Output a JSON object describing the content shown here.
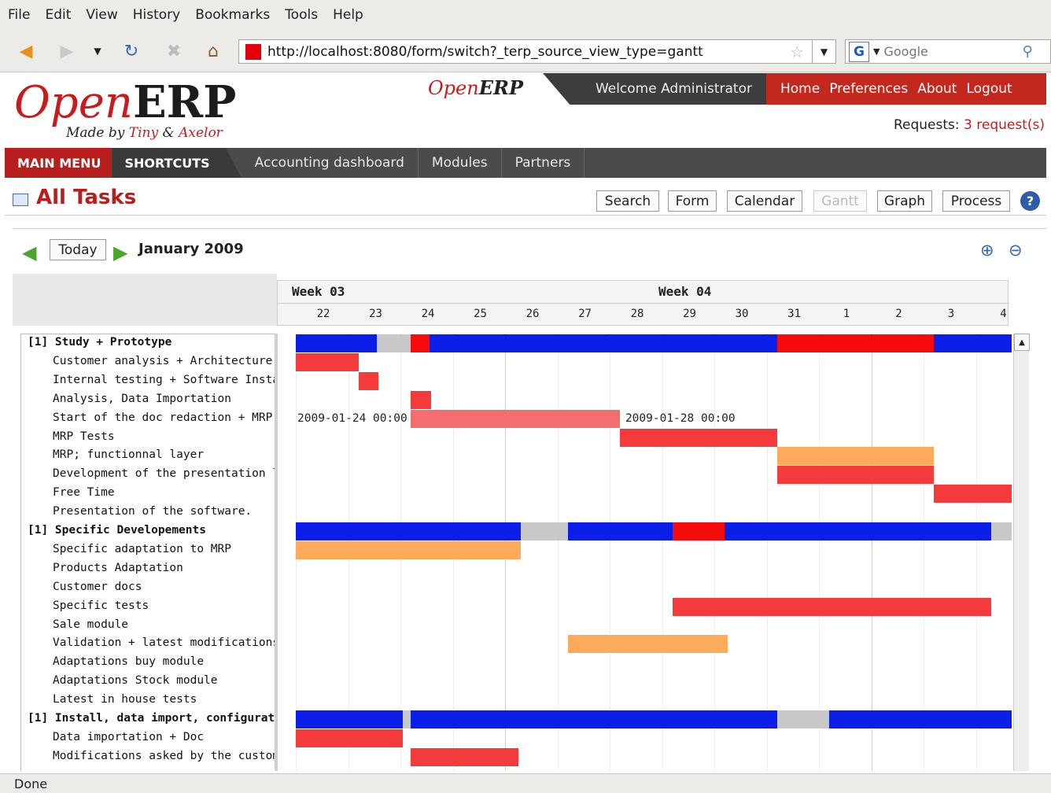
{
  "browser": {
    "menu": [
      "File",
      "Edit",
      "View",
      "History",
      "Bookmarks",
      "Tools",
      "Help"
    ],
    "url": "http://localhost:8080/form/switch?_terp_source_view_type=gantt",
    "search_placeholder": "Google",
    "status": "Done"
  },
  "erp": {
    "logo_open": "Open",
    "logo_erp": "ERP",
    "tagline_pre": "Made by ",
    "tagline_tiny": "Tiny",
    "tagline_mid": " & ",
    "tagline_axelor": "Axelor",
    "welcome": "Welcome Administrator",
    "top_links": [
      "Home",
      "Preferences",
      "About",
      "Logout"
    ],
    "requests_label": "Requests:",
    "requests_value": "3 request(s)",
    "nav": {
      "main_menu": "MAIN MENU",
      "shortcuts": "SHORTCUTS",
      "links": [
        "Accounting dashboard",
        "Modules",
        "Partners"
      ]
    },
    "page_title": "All Tasks",
    "view_buttons": [
      "Search",
      "Form",
      "Calendar",
      "Gantt",
      "Graph",
      "Process"
    ],
    "active_view": "Gantt"
  },
  "gantt": {
    "today_label": "Today",
    "month": "January 2009",
    "weeks": [
      "Week 03",
      "Week 04"
    ],
    "days": [
      "22",
      "23",
      "24",
      "25",
      "26",
      "27",
      "28",
      "29",
      "30",
      "31",
      "1",
      "2",
      "3",
      "4"
    ],
    "colors": {
      "group": "#0b1fe8",
      "group_red": "#f50b0b",
      "gray": "#c8c8c8",
      "red": "#f43a3a",
      "orange": "#fdab5a",
      "pink": "#f46e6e"
    },
    "tasks": [
      {
        "name": "[1] Study + Prototype",
        "group": true
      },
      {
        "name": "Customer analysis + Architecture",
        "group": false
      },
      {
        "name": "Internal testing + Software Install",
        "group": false
      },
      {
        "name": "Analysis, Data Importation",
        "group": false
      },
      {
        "name": "Start of the doc redaction + MRP",
        "group": false
      },
      {
        "name": "MRP Tests",
        "group": false
      },
      {
        "name": "MRP; functionnal layer",
        "group": false
      },
      {
        "name": "Development of the presentation l",
        "group": false
      },
      {
        "name": "Free Time",
        "group": false
      },
      {
        "name": "Presentation of the software.",
        "group": false
      },
      {
        "name": "[1] Specific Developements",
        "group": true
      },
      {
        "name": "Specific adaptation to MRP",
        "group": false
      },
      {
        "name": "Products Adaptation",
        "group": false
      },
      {
        "name": "Customer docs",
        "group": false
      },
      {
        "name": "Specific tests",
        "group": false
      },
      {
        "name": "Sale module",
        "group": false
      },
      {
        "name": "Validation + latest modifications.",
        "group": false
      },
      {
        "name": "Adaptations buy module",
        "group": false
      },
      {
        "name": "Adaptations Stock module",
        "group": false
      },
      {
        "name": "Latest in house tests",
        "group": false
      },
      {
        "name": "[1] Install, data import, configurat",
        "group": true
      },
      {
        "name": "Data importation + Doc",
        "group": false
      },
      {
        "name": "Modifications asked by the custom",
        "group": false
      }
    ],
    "bars": [
      {
        "row": 0,
        "start": 0,
        "end": 1.2,
        "color": "group"
      },
      {
        "row": 0,
        "start": 1.2,
        "end": 1.55,
        "color": "group"
      },
      {
        "row": 0,
        "start": 1.55,
        "end": 2.2,
        "color": "gray"
      },
      {
        "row": 0,
        "start": 2.2,
        "end": 2.55,
        "color": "group_red"
      },
      {
        "row": 0,
        "start": 2.55,
        "end": 9.2,
        "color": "group"
      },
      {
        "row": 0,
        "start": 9.2,
        "end": 12.2,
        "color": "group_red"
      },
      {
        "row": 0,
        "start": 12.2,
        "end": 13.9,
        "color": "group"
      },
      {
        "row": 1,
        "start": 0,
        "end": 1.2,
        "color": "red"
      },
      {
        "row": 2,
        "start": 1.2,
        "end": 1.58,
        "color": "red"
      },
      {
        "row": 3,
        "start": 2.2,
        "end": 2.58,
        "color": "red"
      },
      {
        "row": 4,
        "start": 2.2,
        "end": 6.2,
        "color": "pink"
      },
      {
        "row": 5,
        "start": 6.2,
        "end": 9.2,
        "color": "red"
      },
      {
        "row": 6,
        "start": 9.2,
        "end": 12.2,
        "color": "orange"
      },
      {
        "row": 7,
        "start": 9.2,
        "end": 12.2,
        "color": "red"
      },
      {
        "row": 8,
        "start": 12.2,
        "end": 13.9,
        "color": "red"
      },
      {
        "row": 10,
        "start": 0,
        "end": 4.3,
        "color": "group"
      },
      {
        "row": 10,
        "start": 4.3,
        "end": 5.2,
        "color": "gray"
      },
      {
        "row": 10,
        "start": 5.2,
        "end": 7.2,
        "color": "group"
      },
      {
        "row": 10,
        "start": 7.2,
        "end": 8.2,
        "color": "group_red"
      },
      {
        "row": 10,
        "start": 8.2,
        "end": 13.3,
        "color": "group"
      },
      {
        "row": 10,
        "start": 13.3,
        "end": 13.9,
        "color": "gray"
      },
      {
        "row": 11,
        "start": 0,
        "end": 4.3,
        "color": "orange"
      },
      {
        "row": 14,
        "start": 7.2,
        "end": 13.3,
        "color": "red"
      },
      {
        "row": 16,
        "start": 5.2,
        "end": 8.25,
        "color": "orange"
      },
      {
        "row": 20,
        "start": 0,
        "end": 2.05,
        "color": "group"
      },
      {
        "row": 20,
        "start": 2.05,
        "end": 2.2,
        "color": "gray"
      },
      {
        "row": 20,
        "start": 2.2,
        "end": 9.2,
        "color": "group"
      },
      {
        "row": 20,
        "start": 9.2,
        "end": 10.2,
        "color": "gray"
      },
      {
        "row": 20,
        "start": 10.2,
        "end": 13.9,
        "color": "group"
      },
      {
        "row": 21,
        "start": 0,
        "end": 2.05,
        "color": "red"
      },
      {
        "row": 22,
        "start": 2.2,
        "end": 4.25,
        "color": "red"
      }
    ],
    "bar_labels": [
      {
        "row": 4,
        "text": "2009-01-24 00:00",
        "at": 0,
        "align": "start"
      },
      {
        "row": 4,
        "text": "2009-01-28 00:00",
        "at": 6.27,
        "align": "start"
      }
    ]
  }
}
